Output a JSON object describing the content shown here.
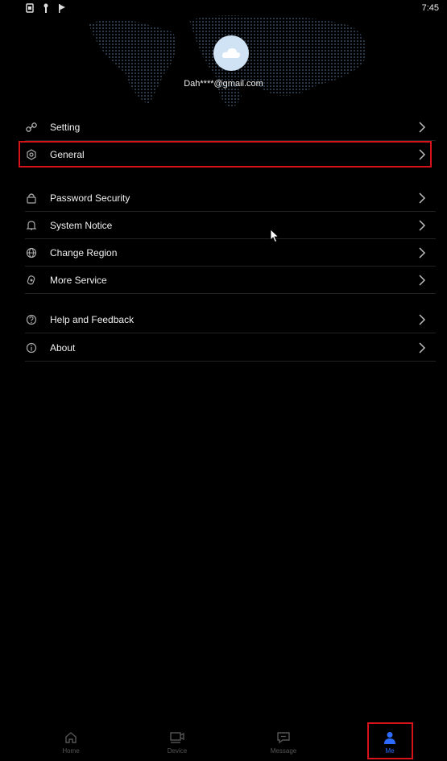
{
  "status_bar": {
    "time": "7:45"
  },
  "profile": {
    "email": "Dah****@gmail.com"
  },
  "menu": {
    "groups": [
      [
        {
          "label": "Setting",
          "icon": "link-icon"
        },
        {
          "label": "General",
          "icon": "gear-icon"
        }
      ],
      [
        {
          "label": "Password Security",
          "icon": "lock-icon"
        },
        {
          "label": "System Notice",
          "icon": "bell-icon"
        },
        {
          "label": "Change Region",
          "icon": "globe-icon"
        },
        {
          "label": "More Service",
          "icon": "more-service-icon"
        }
      ],
      [
        {
          "label": "Help and Feedback",
          "icon": "help-icon"
        },
        {
          "label": "About",
          "icon": "info-icon"
        }
      ]
    ]
  },
  "tabbar": {
    "tabs": [
      {
        "label": "Home",
        "icon": "home-icon"
      },
      {
        "label": "Device",
        "icon": "device-icon"
      },
      {
        "label": "Message",
        "icon": "message-icon"
      },
      {
        "label": "Me",
        "icon": "person-icon",
        "active": true
      }
    ]
  },
  "colors": {
    "accent": "#2d6bff",
    "highlight": "#d8121b",
    "background": "#000000"
  }
}
